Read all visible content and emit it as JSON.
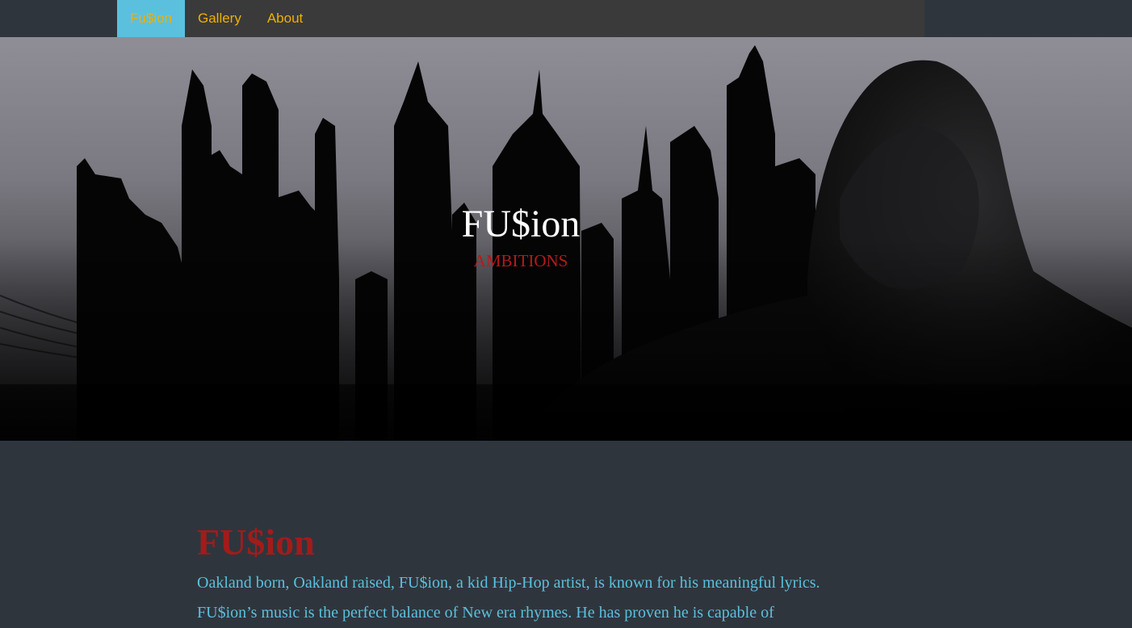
{
  "nav": {
    "items": [
      {
        "label": "Fu$ion",
        "active": true
      },
      {
        "label": "Gallery",
        "active": false
      },
      {
        "label": "About",
        "active": false
      }
    ],
    "accent": "#5bc0de",
    "link_color": "#f0b000"
  },
  "hero": {
    "title": "FU$ion",
    "subtitle": "AMBITIONS",
    "image": "city-skyline-hooded-figure-silhouette"
  },
  "intro": {
    "heading": "FU$ion",
    "body": "Oakland born, Oakland raised, FU$ion, a kid Hip-Hop artist, is known for his meaningful lyrics. FU$ion’s music is the perfect balance of New era rhymes. He has proven he is capable of"
  },
  "colors": {
    "background": "#2f353d",
    "heading_red": "#a31b1b",
    "body_cyan": "#5bc0de",
    "subtitle_red": "#b51a1a"
  }
}
